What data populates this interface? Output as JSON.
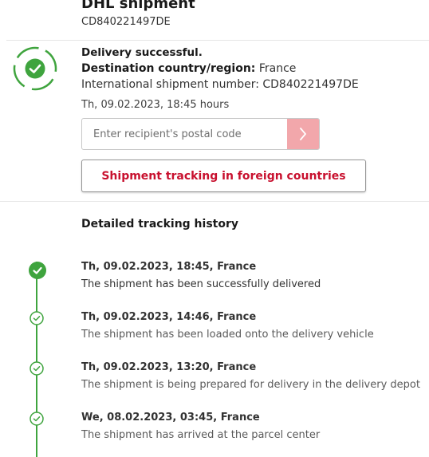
{
  "shipment": {
    "title": "DHL shipment",
    "number": "CD840221497DE"
  },
  "status": {
    "headline": "Delivery successful.",
    "country_label": "Destination country/region:",
    "country_value": "France",
    "intl_number_text": "International shipment number: CD840221497DE",
    "datetime": "Th, 09.02.2023, 18:45 hours",
    "icon": "check-circle-icon",
    "color": "#3fa43e"
  },
  "postal": {
    "placeholder": "Enter recipient's postal code",
    "button_icon": "chevron-right-icon",
    "button_color": "#f2a7ab"
  },
  "foreign_button": {
    "label": "Shipment tracking in foreign countries",
    "color": "#c8102e"
  },
  "history": {
    "heading": "Detailed tracking history",
    "events": [
      {
        "date": "Th, 09.02.2023, 18:45, France",
        "desc": "The shipment has been successfully delivered"
      },
      {
        "date": "Th, 09.02.2023, 14:46, France",
        "desc": "The shipment has been loaded onto the delivery vehicle"
      },
      {
        "date": "Th, 09.02.2023, 13:20, France",
        "desc": "The shipment is being prepared for delivery in the delivery depot"
      },
      {
        "date": "We, 08.02.2023, 03:45, France",
        "desc": "The shipment has arrived at the parcel center"
      }
    ]
  }
}
